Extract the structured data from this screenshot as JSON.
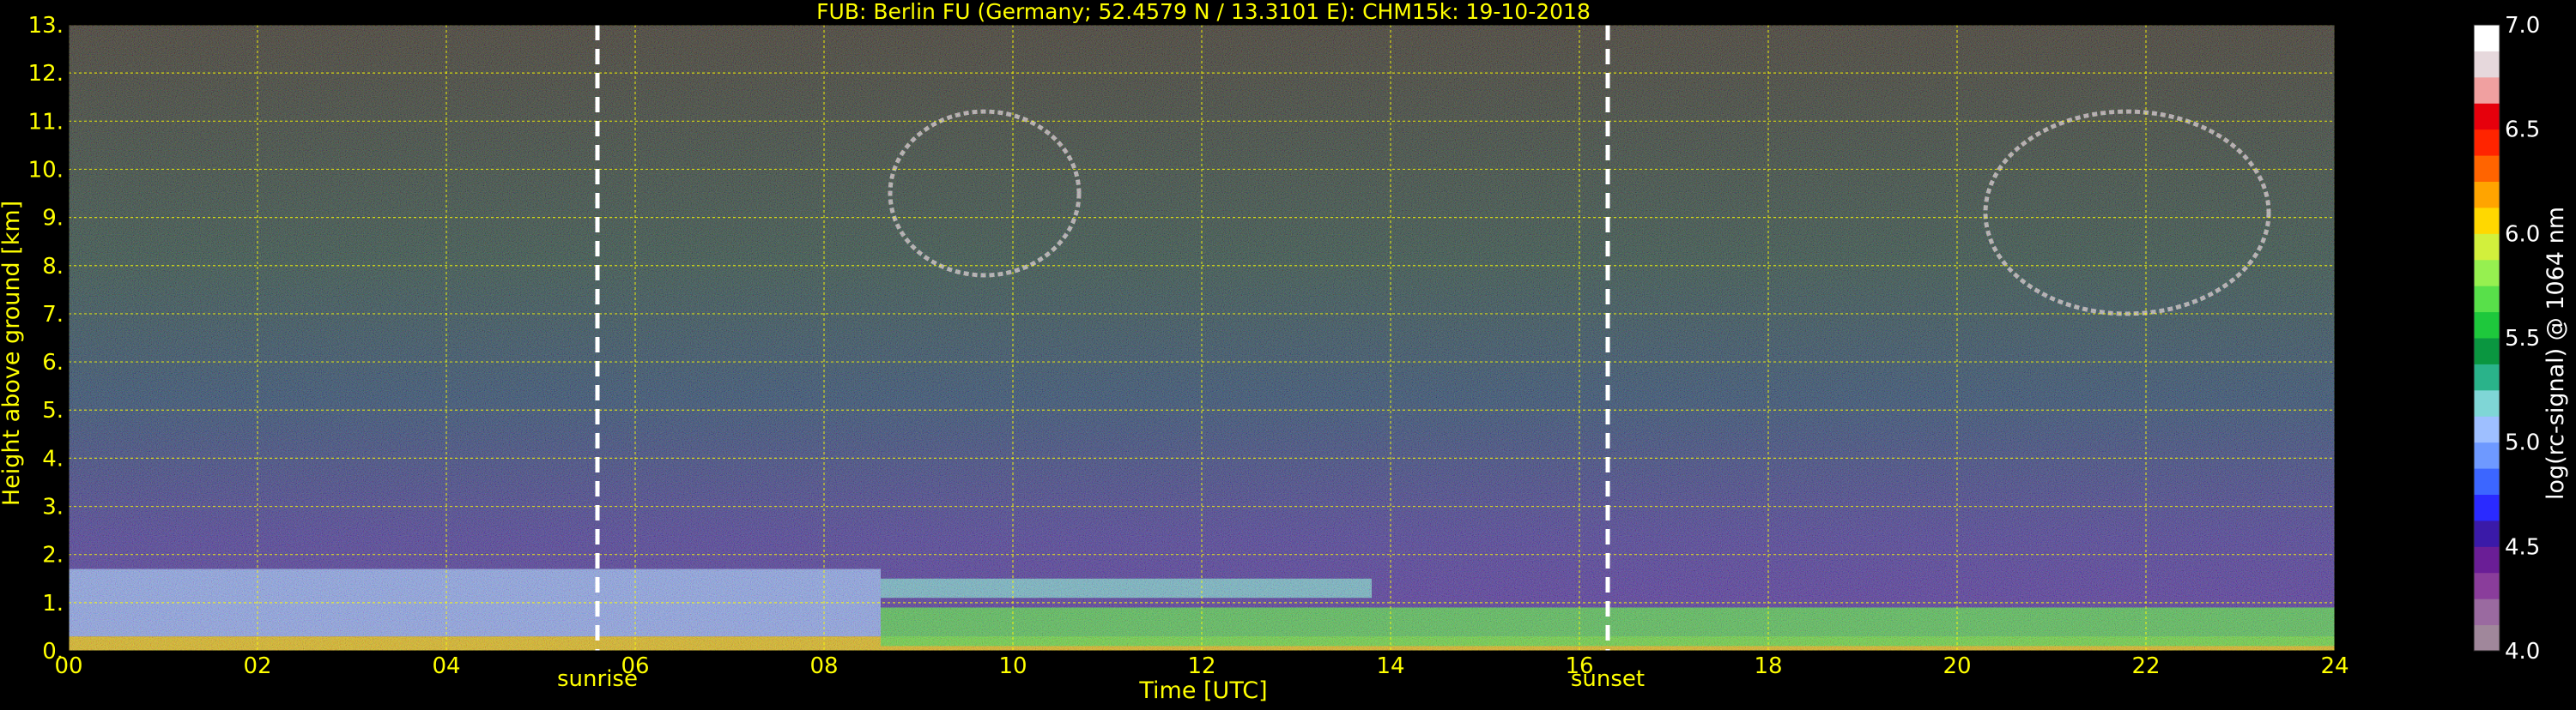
{
  "chart_data": {
    "type": "heatmap",
    "title": "FUB: Berlin FU (Germany; 52.4579 N / 13.3101 E):    CHM15k: 19-10-2018",
    "xlabel": "Time [UTC]",
    "ylabel": "Height above ground [km]",
    "xlim": [
      0,
      24
    ],
    "ylim": [
      0,
      13
    ],
    "x_ticks": [
      "00",
      "02",
      "04",
      "06",
      "08",
      "10",
      "12",
      "14",
      "16",
      "18",
      "20",
      "22",
      "24"
    ],
    "y_ticks": [
      "0.",
      "1.",
      "2.",
      "3.",
      "4.",
      "5.",
      "6.",
      "7.",
      "8.",
      "9.",
      "10.",
      "11.",
      "12.",
      "13."
    ],
    "grid": true,
    "markers": [
      {
        "label": "sunrise",
        "x": 5.6
      },
      {
        "label": "sunset",
        "x": 16.3
      }
    ],
    "colorbar": {
      "label": "log(rc-signal) @ 1064 nm",
      "range": [
        4.0,
        7.0
      ],
      "ticks": [
        "4.0",
        "4.5",
        "5.0",
        "5.5",
        "6.0",
        "6.5",
        "7.0"
      ],
      "colors": [
        "#a0879b",
        "#9a6aa0",
        "#8a3d9b",
        "#6a1e96",
        "#3a1aa8",
        "#2a2aff",
        "#3c66ff",
        "#6e99ff",
        "#9ebfff",
        "#7fd6d6",
        "#2ab38a",
        "#0a9640",
        "#1ec83c",
        "#58e04a",
        "#96f050",
        "#d2f03c",
        "#ffd800",
        "#ffa400",
        "#ff6400",
        "#ff2400",
        "#e6000c",
        "#f0a0a0",
        "#e6d8dc",
        "#ffffff"
      ]
    },
    "layers": [
      {
        "x": [
          0,
          24
        ],
        "y": [
          0,
          0.3
        ],
        "log_signal": 6.0
      },
      {
        "x": [
          0,
          8.6
        ],
        "y": [
          0.3,
          1.7
        ],
        "log_signal": 5.0
      },
      {
        "x": [
          8.6,
          24
        ],
        "y": [
          0.1,
          0.9
        ],
        "log_signal": 5.7
      },
      {
        "x": [
          8.6,
          13.8
        ],
        "y": [
          1.1,
          1.5
        ],
        "log_signal": 5.2
      }
    ],
    "clouds": [
      {
        "x": [
          8.7,
          10.7
        ],
        "y": [
          7.8,
          11.2
        ],
        "log_signal": 6.8
      },
      {
        "x": [
          20.3,
          23.3
        ],
        "y": [
          7.0,
          11.2
        ],
        "log_signal": 6.8
      }
    ]
  }
}
